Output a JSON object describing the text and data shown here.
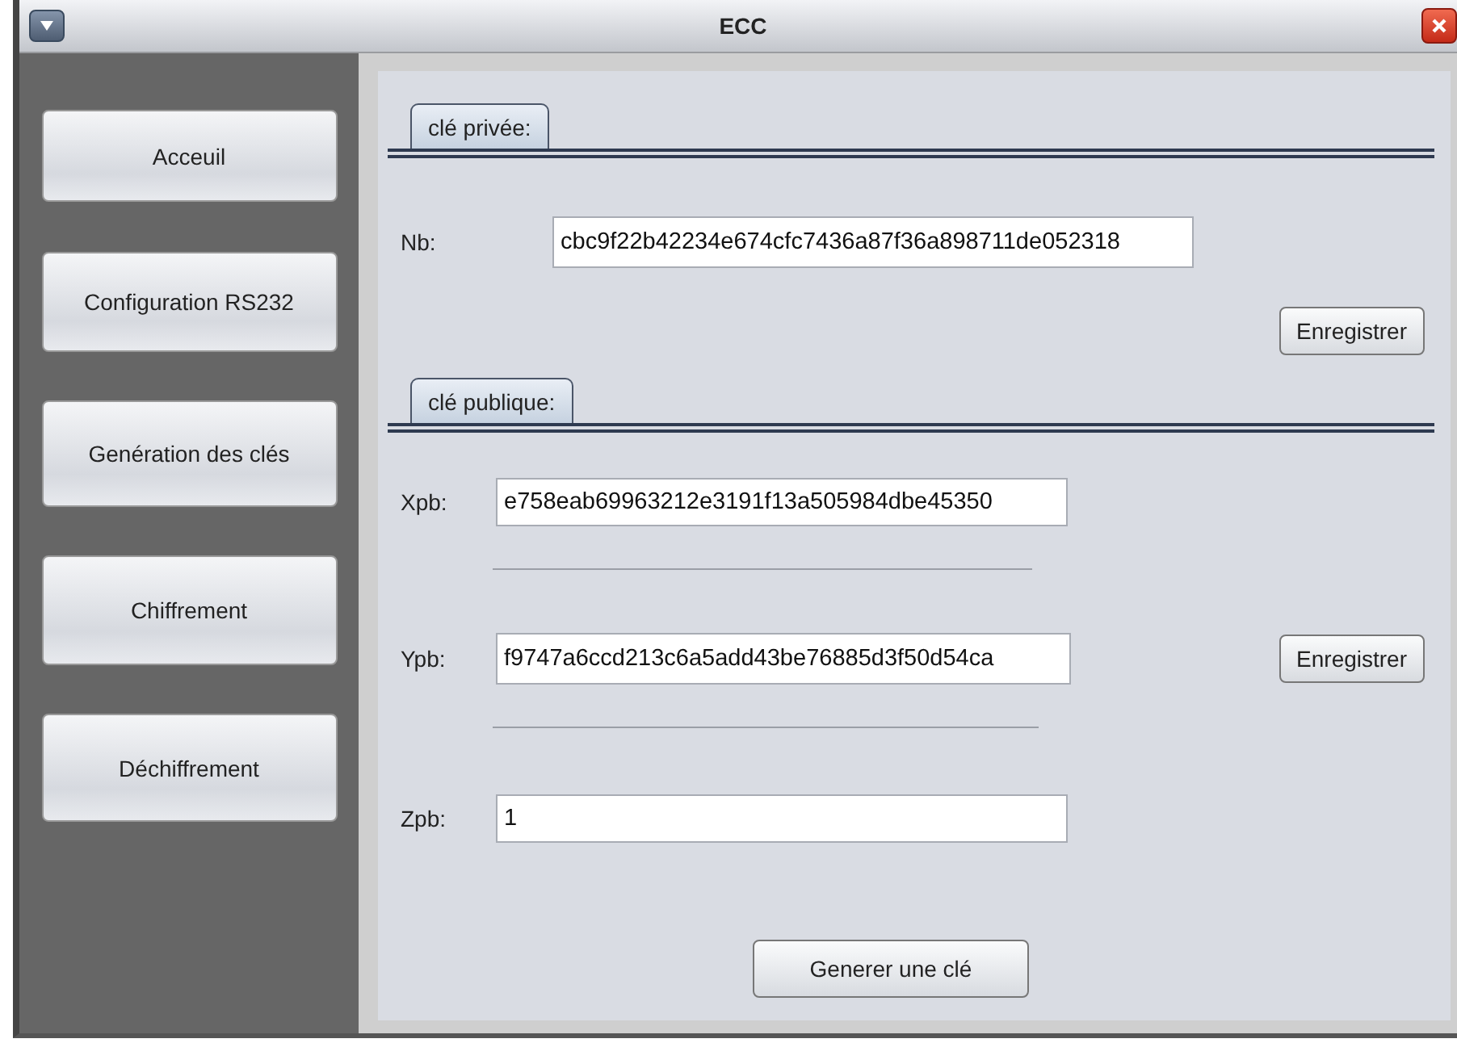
{
  "window": {
    "title": "ECC"
  },
  "sidebar": {
    "items": [
      {
        "label": "Acceuil"
      },
      {
        "label": "Configuration  RS232"
      },
      {
        "label": "Genération des clés"
      },
      {
        "label": "Chiffrement"
      },
      {
        "label": "Déchiffrement"
      }
    ]
  },
  "private_key": {
    "tab": "clé privée:",
    "field": {
      "label": "Nb:",
      "value": "cbc9f22b42234e674cfc7436a87f36a898711de052318"
    },
    "button": "Enregistrer"
  },
  "public_key": {
    "tab": "clé publique:",
    "fields": [
      {
        "label": "Xpb:",
        "value": "e758eab69963212e3191f13a505984dbe45350"
      },
      {
        "label": "Ypb:",
        "value": "f9747a6ccd213c6a5add43be76885d3f50d54ca"
      },
      {
        "label": "Zpb:",
        "value": "1"
      }
    ],
    "button": "Enregistrer"
  },
  "generate_button": "Generer une clé"
}
